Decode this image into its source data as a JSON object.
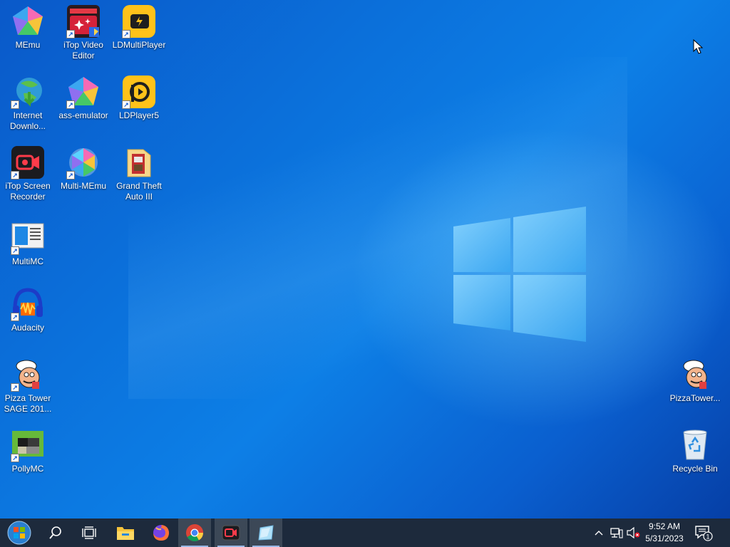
{
  "desktop": {
    "icons": [
      {
        "id": "memu",
        "label": "MEmu"
      },
      {
        "id": "itop-video",
        "label": "iTop Video Editor"
      },
      {
        "id": "ldmulti",
        "label": "LDMultiPlayer"
      },
      {
        "id": "idm",
        "label": "Internet Downlo..."
      },
      {
        "id": "ass-emulator",
        "label": "ass-emulator"
      },
      {
        "id": "ldplayer5",
        "label": "LDPlayer5"
      },
      {
        "id": "itop-screen",
        "label": "iTop Screen Recorder"
      },
      {
        "id": "multi-memu",
        "label": "Multi-MEmu"
      },
      {
        "id": "gta3",
        "label": "Grand Theft Auto III"
      },
      {
        "id": "multimc",
        "label": "MultiMC"
      },
      {
        "id": "audacity",
        "label": "Audacity"
      },
      {
        "id": "pizza-sage",
        "label": "Pizza Tower SAGE 201..."
      },
      {
        "id": "pollymc",
        "label": "PollyMC"
      },
      {
        "id": "pizzatower",
        "label": "PizzaTower..."
      },
      {
        "id": "recycle",
        "label": "Recycle Bin"
      }
    ]
  },
  "taskbar": {
    "clock_time": "9:52 AM",
    "clock_date": "5/31/2023",
    "notification_count": "1"
  },
  "colors": {
    "taskbar_bg": "#1d2a3c",
    "desktop_blue": "#0b72dc"
  }
}
